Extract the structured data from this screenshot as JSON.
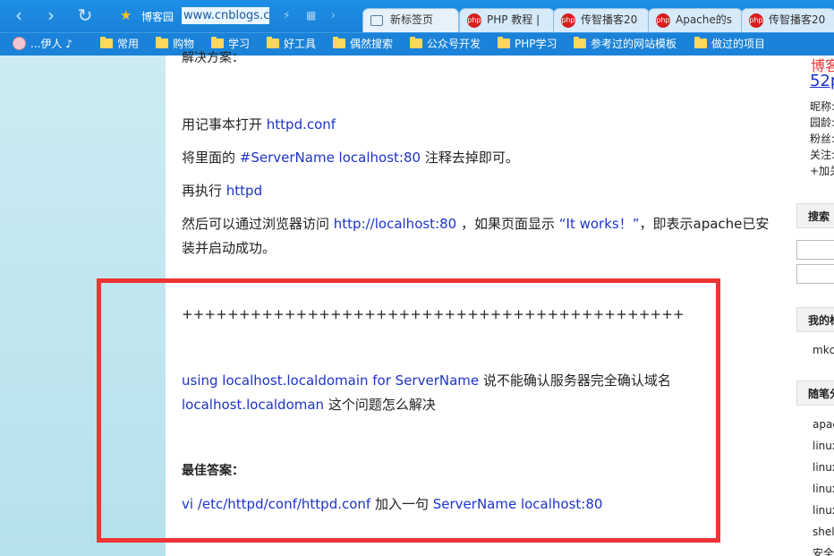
{
  "browser": {
    "site_name": "博客园",
    "url": "www.cnblogs.com",
    "tabs": [
      {
        "label": "新标签页",
        "icon": "page-icon"
      },
      {
        "label": "PHP 教程 |",
        "icon": "php-icon"
      },
      {
        "label": "传智播客20",
        "icon": "php-icon"
      },
      {
        "label": "Apache的s",
        "icon": "php-icon"
      },
      {
        "label": "传智播客20",
        "icon": "php-icon"
      }
    ],
    "bookmarks": [
      "...伊人 ♪",
      "常用",
      "购物",
      "学习",
      "好工具",
      "偶然搜索",
      "公众号开发",
      "PHP学习",
      "参考过的网站模板",
      "做过的项目"
    ],
    "accent_color": "#1a82d8"
  },
  "article": {
    "heading_partial": "解决方案：",
    "line1": {
      "prefix": "用记事本打开 ",
      "link": "httpd.conf"
    },
    "line2": {
      "prefix": "将里面的 ",
      "code": "#ServerName localhost:80",
      "suffix": " 注释去掉即可。"
    },
    "line3": {
      "prefix": "再执行 ",
      "code": "httpd"
    },
    "line4": {
      "prefix": "然后可以通过浏览器访问 ",
      "link": "http://localhost:80",
      "mid": " ，如果页面显示 ",
      "quote": "“It works！”",
      "suffix": "，即表示apache已安"
    },
    "line4b": "装并启动成功。",
    "separator": "++++++++++++++++++++++++++++++++++++++++++++",
    "q_line1": {
      "code": "using localhost.localdomain for ServerName",
      "suffix": "  说不能确认服务器完全确认域名"
    },
    "q_line2": {
      "code": "localhost.localdoman",
      "suffix": "  这个问题怎么解决"
    },
    "answer_label": "最佳答案：",
    "a_line": {
      "code1": "vi /etc/httpd/conf/httpd.conf",
      "mid": "    加入一句  ",
      "code2": "ServerName  localhost:80"
    },
    "highlight_color": "#ee3434"
  },
  "sidebar": {
    "blog_title_partial": "博客",
    "blog_url_partial": "52p",
    "info": [
      "昵称:",
      "园龄:",
      "粉丝:",
      "关注:",
      "+加关"
    ],
    "search_head": "搜索",
    "my_head": "我的标",
    "my_item": "mkc",
    "cat_head": "随笔分",
    "cat_items": [
      "apac",
      "linux",
      "linux",
      "linux",
      "linux",
      "shell",
      "安全"
    ]
  }
}
